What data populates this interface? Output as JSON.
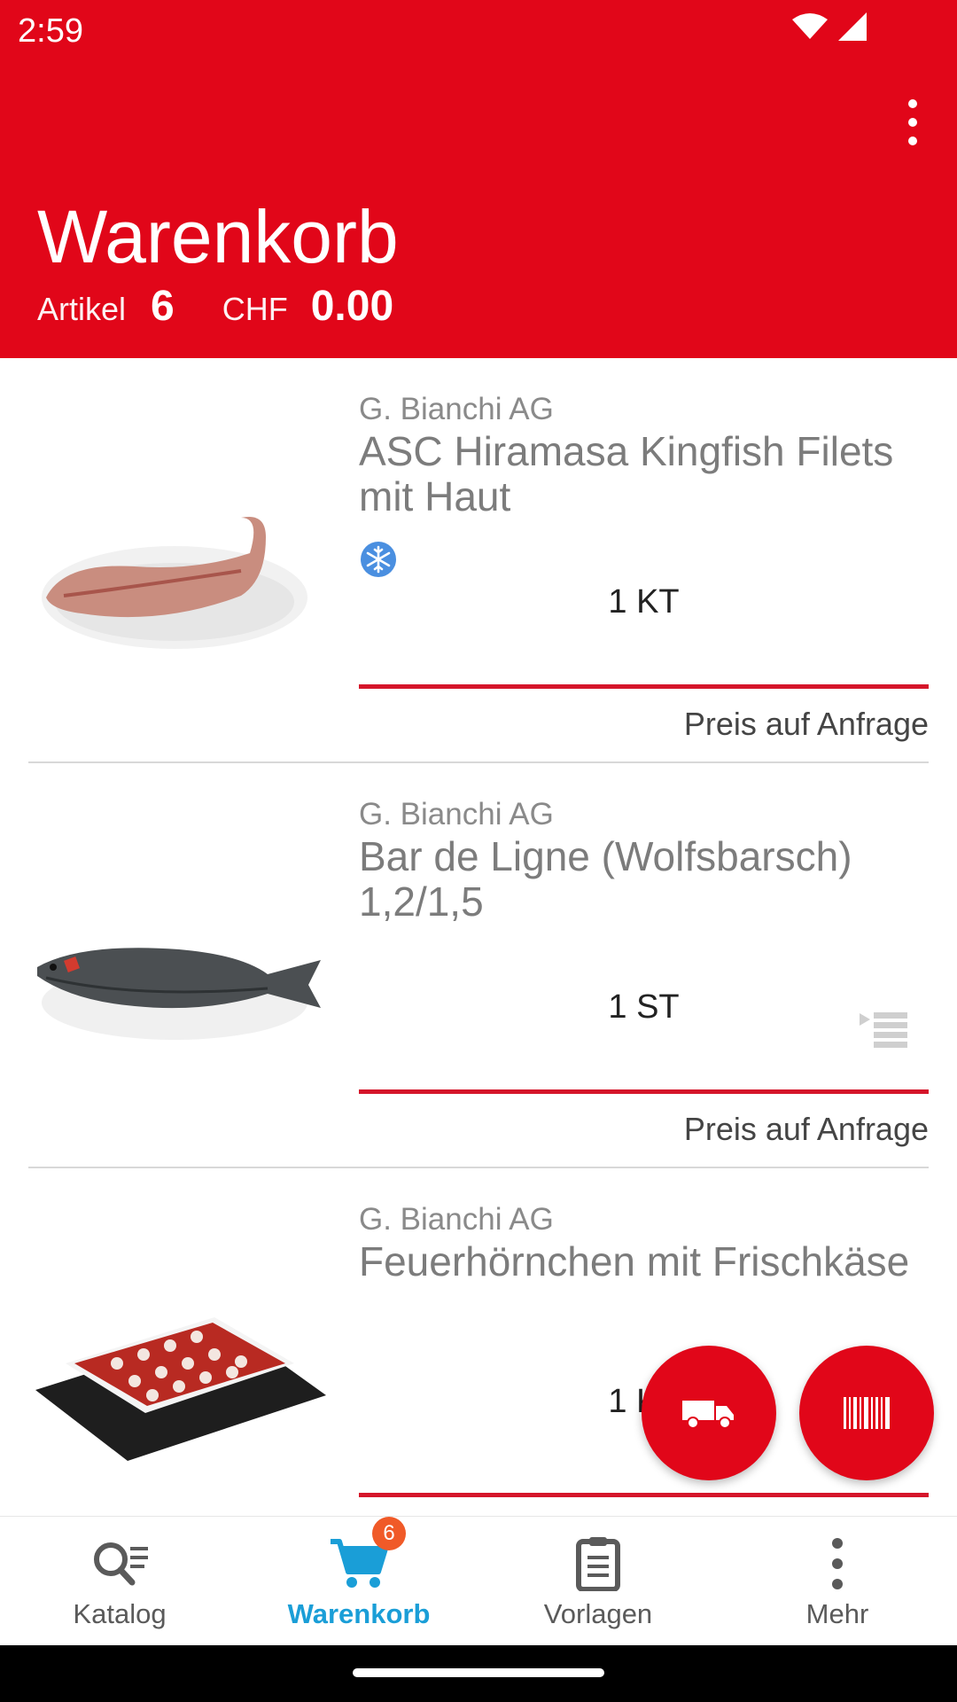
{
  "status_bar": {
    "time": "2:59"
  },
  "header": {
    "title": "Warenkorb",
    "articles_label": "Artikel",
    "articles_count": "6",
    "currency_label": "CHF",
    "total": "0.00",
    "brand_color": "#e10619"
  },
  "items": [
    {
      "supplier": "G. Bianchi AG",
      "name": "ASC Hiramasa Kingfish Filets mit Haut",
      "frozen_icon": "snowflake-icon",
      "quantity": "1 KT",
      "price": "Preis auf Anfrage"
    },
    {
      "supplier": "G. Bianchi AG",
      "name": "Bar de Ligne (Wolfsbarsch) 1,2/1,5",
      "quantity": "1 ST",
      "price": "Preis auf Anfrage"
    },
    {
      "supplier": "G. Bianchi AG",
      "name": "Feuerhörnchen mit Frischkäse",
      "quantity": "1 KT",
      "price": ""
    }
  ],
  "fabs": {
    "delivery_icon": "truck-icon",
    "scan_icon": "barcode-icon"
  },
  "bottom_nav": {
    "active_color": "#1a9ed7",
    "cart_badge": "6",
    "items": [
      {
        "label": "Katalog",
        "icon": "catalog-search-icon"
      },
      {
        "label": "Warenkorb",
        "icon": "cart-icon"
      },
      {
        "label": "Vorlagen",
        "icon": "clipboard-icon"
      },
      {
        "label": "Mehr",
        "icon": "more-vertical-icon"
      }
    ]
  }
}
